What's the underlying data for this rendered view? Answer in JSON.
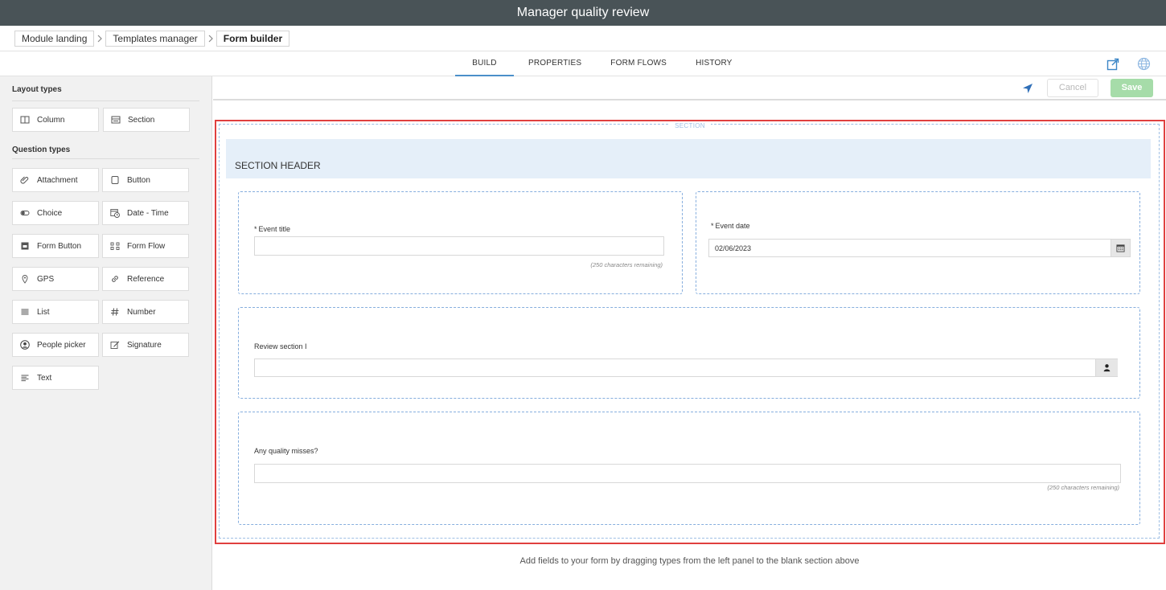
{
  "window": {
    "title": "Manager quality review"
  },
  "breadcrumb": [
    {
      "label": "Module landing"
    },
    {
      "label": "Templates manager"
    },
    {
      "label": "Form builder"
    }
  ],
  "tabs": [
    {
      "label": "BUILD",
      "active": true
    },
    {
      "label": "PROPERTIES"
    },
    {
      "label": "FORM FLOWS"
    },
    {
      "label": "HISTORY"
    }
  ],
  "tabbar_icons": {
    "edit": "external-edit-icon",
    "globe": "globe-icon",
    "accent": "#3b86c6"
  },
  "sidebar": {
    "layout_heading": "Layout types",
    "layout_items": [
      {
        "label": "Column",
        "icon": "column-icon"
      },
      {
        "label": "Section",
        "icon": "section-icon"
      }
    ],
    "question_heading": "Question types",
    "question_items": [
      {
        "label": "Attachment",
        "icon": "paperclip-icon"
      },
      {
        "label": "Button",
        "icon": "button-icon"
      },
      {
        "label": "Choice",
        "icon": "toggle-icon"
      },
      {
        "label": "Date - Time",
        "icon": "calendar-clock-icon"
      },
      {
        "label": "Form Button",
        "icon": "form-button-icon"
      },
      {
        "label": "Form Flow",
        "icon": "flow-icon"
      },
      {
        "label": "GPS",
        "icon": "map-pin-icon"
      },
      {
        "label": "Reference",
        "icon": "link-icon"
      },
      {
        "label": "List",
        "icon": "list-icon"
      },
      {
        "label": "Number",
        "icon": "hash-icon"
      },
      {
        "label": "People picker",
        "icon": "person-circle-icon"
      },
      {
        "label": "Signature",
        "icon": "pencil-square-icon"
      },
      {
        "label": "Text",
        "icon": "text-lines-icon"
      }
    ]
  },
  "actions": {
    "cancel_label": "Cancel",
    "save_label": "Save",
    "save_color": "#a6dca9",
    "nav_icon": "navigate-arrow-icon"
  },
  "section": {
    "label": "SECTION",
    "header": "SECTION HEADER",
    "header_bg": "#e5eff9",
    "highlight_color": "#e0403f"
  },
  "fields": {
    "event_title": {
      "required_mark": "*",
      "label": "Event title",
      "value": "",
      "remaining": "(250 characters remaining)"
    },
    "event_date": {
      "required_mark": "*",
      "label": "Event date",
      "value": "02/06/2023",
      "icon": "calendar-icon"
    },
    "review_section": {
      "label": "Review section I",
      "value": "",
      "icon": "person-icon"
    },
    "quality_misses": {
      "label": "Any quality misses?",
      "value": "",
      "remaining": "(250 characters remaining)"
    }
  },
  "hint": "Add fields to your form by dragging types from the left panel to the blank section above"
}
